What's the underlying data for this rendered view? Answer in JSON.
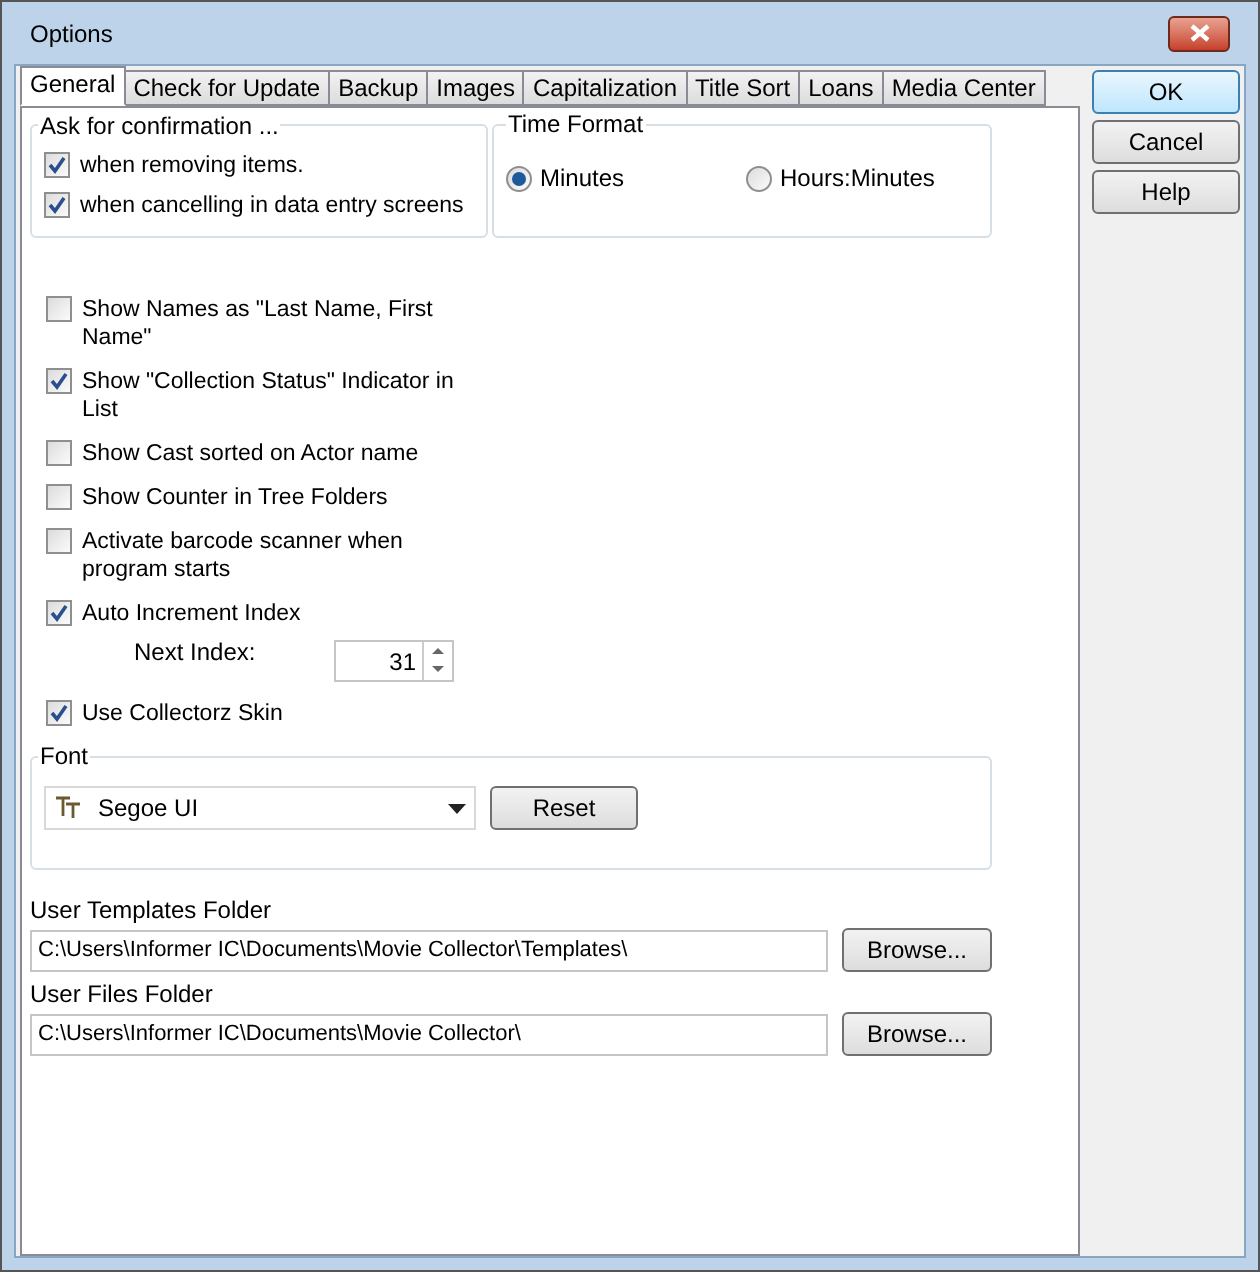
{
  "window": {
    "title": "Options"
  },
  "tabs": [
    {
      "label": "General",
      "selected": true
    },
    {
      "label": "Check for Update",
      "selected": false
    },
    {
      "label": "Backup",
      "selected": false
    },
    {
      "label": "Images",
      "selected": false
    },
    {
      "label": "Capitalization",
      "selected": false
    },
    {
      "label": "Title Sort",
      "selected": false
    },
    {
      "label": "Loans",
      "selected": false
    },
    {
      "label": "Media Center",
      "selected": false
    }
  ],
  "confirmation": {
    "title": "Ask for confirmation ...",
    "items": [
      {
        "label": "when removing items.",
        "checked": true
      },
      {
        "label": "when cancelling in data entry screens",
        "checked": true
      }
    ]
  },
  "time_format": {
    "title": "Time Format",
    "options": [
      {
        "label": "Minutes",
        "selected": true
      },
      {
        "label": "Hours:Minutes",
        "selected": false
      }
    ]
  },
  "options": [
    {
      "label": "Show Names as \"Last Name, First Name\"",
      "checked": false
    },
    {
      "label": "Show \"Collection Status\" Indicator in List",
      "checked": true
    },
    {
      "label": "Show Cast sorted on Actor name",
      "checked": false
    },
    {
      "label": "Show Counter in Tree Folders",
      "checked": false
    },
    {
      "label": "Activate barcode scanner when program starts",
      "checked": false
    },
    {
      "label": "Auto Increment Index",
      "checked": true
    }
  ],
  "next_index": {
    "label": "Next Index:",
    "value": "31"
  },
  "skin": {
    "label": "Use Collectorz Skin",
    "checked": true
  },
  "font": {
    "title": "Font",
    "value": "Segoe UI",
    "reset": "Reset"
  },
  "folders": [
    {
      "label": "User Templates Folder",
      "value": "C:\\Users\\Informer IC\\Documents\\Movie Collector\\Templates\\",
      "button": "Browse..."
    },
    {
      "label": "User Files Folder",
      "value": "C:\\Users\\Informer IC\\Documents\\Movie Collector\\",
      "button": "Browse..."
    }
  ],
  "buttons": [
    {
      "label": "OK",
      "kind": "default"
    },
    {
      "label": "Cancel",
      "kind": "normal"
    },
    {
      "label": "Help",
      "kind": "normal"
    }
  ]
}
